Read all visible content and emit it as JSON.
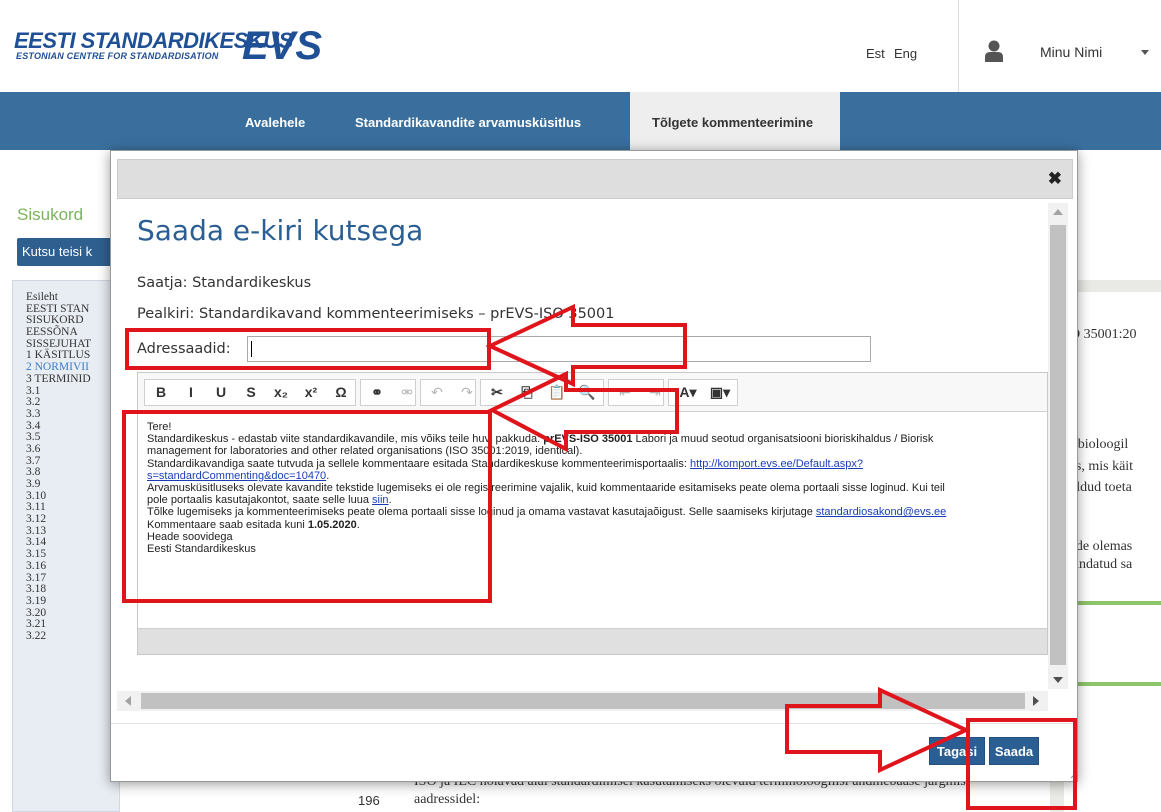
{
  "header": {
    "logo_main": "EESTI STANDARDIKESKUS",
    "logo_sub": "ESTONIAN CENTRE FOR STANDARDISATION",
    "logo_mark": "EVS",
    "lang_est": "Est",
    "lang_eng": "Eng",
    "user_icon": "user-icon",
    "user_name": "Minu Nimi"
  },
  "nav": {
    "items": [
      {
        "label": "Avalehele"
      },
      {
        "label": "Standardikavandite arvamusküsitlus"
      },
      {
        "label": "Tõlgete kommenteerimine"
      }
    ]
  },
  "background": {
    "section_title": "Sisukord",
    "invite_button": "Kutsu teisi k",
    "toc": [
      "Esileht",
      "EESTI STAN",
      "SISUKORD",
      "EESSÕNA",
      "SISSEJUHAT",
      "1 KÄSITLUS",
      "2 NORMIVII",
      "3 TERMINID",
      "3.1",
      "3.2",
      "3.3",
      "3.4",
      "3.5",
      "3.6",
      "3.7",
      "3.8",
      "3.9",
      "3.10",
      "3.11",
      "3.12",
      "3.13",
      "3.14",
      "3.15",
      "3.16",
      "3.17",
      "3.18",
      "3.19",
      "3.20",
      "3.21",
      "3.22"
    ],
    "right_snippets": [
      "O 35001:20",
      "e bioloogil",
      "is, mis käit",
      "eldud toeta",
      "ide olemas",
      "undatud sa"
    ],
    "bottom_line1": "ISO ja IEC hoiavad alal standardimisel kasutamiseks olevaid terminoloogilisi andmebaase järgmis",
    "bottom_line2": "aadressidel:",
    "bottom_number": "196"
  },
  "modal": {
    "close_icon": "close-icon",
    "title": "Saada e-kiri kutsega",
    "sender_label": "Saatja:",
    "sender_value": "Standardikeskus",
    "subject_label": "Pealkiri:",
    "subject_value": "Standardikavand kommenteerimiseks – prEVS-ISO 35001",
    "recipients_label": "Adressaadid:",
    "recipients_value": "",
    "toolbar": [
      {
        "icon": "bold-icon",
        "glyph": "B"
      },
      {
        "icon": "italic-icon",
        "glyph": "I"
      },
      {
        "icon": "underline-icon",
        "glyph": "U"
      },
      {
        "icon": "strikethrough-icon",
        "glyph": "S"
      },
      {
        "icon": "subscript-icon",
        "glyph": "x₂"
      },
      {
        "icon": "superscript-icon",
        "glyph": "x²"
      },
      {
        "icon": "special-char-icon",
        "glyph": "Ω"
      },
      {
        "icon": "link-icon",
        "glyph": "⚭"
      },
      {
        "icon": "unlink-icon",
        "glyph": "⚮"
      },
      {
        "icon": "undo-icon",
        "glyph": "↶"
      },
      {
        "icon": "redo-icon",
        "glyph": "↷"
      },
      {
        "icon": "cut-icon",
        "glyph": "✂"
      },
      {
        "icon": "copy-icon",
        "glyph": "⎘"
      },
      {
        "icon": "paste-icon",
        "glyph": "📋"
      },
      {
        "icon": "find-icon",
        "glyph": "🔍"
      },
      {
        "icon": "replace-icon",
        "glyph": "ᵇa"
      },
      {
        "icon": "outdent-icon",
        "glyph": "⇤"
      },
      {
        "icon": "indent-icon",
        "glyph": "⇥"
      },
      {
        "icon": "text-color-icon",
        "glyph": "A▾"
      },
      {
        "icon": "bg-color-icon",
        "glyph": "▣▾"
      }
    ],
    "body": {
      "greeting": "Tere!",
      "l1_pre": "Standardikeskus - edastab viite standardikavandile, mis võiks teile huvi pakkuda: ",
      "l1_bold": "prEVS-ISO 35001",
      "l1_post": " Labori ja muud seotud organisatsiooni bioriskihaldus / Biorisk",
      "l2": "management for laboratories and other related organisations (ISO 35001:2019, identical).",
      "l3_pre": "Standardikavandiga saate tutvuda ja sellele kommentaare esitada Standardikeskuse kommenteerimisportaalis: ",
      "l3_link": "http://komport.evs.ee/Default.aspx?",
      "l4_link": "s=standardCommenting&doc=10470",
      "l4_post": ".",
      "l5": "Arvamusküsitluseks olevate kavandite tekstide lugemiseks ei ole registreerimine vajalik, kuid kommentaaride esitamiseks peate olema portaali sisse loginud. Kui teil",
      "l6_pre": "pole portaalis kasutajakontot, saate selle luua ",
      "l6_link": "siin",
      "l6_post": ".",
      "l7_pre": "Tõlke lugemiseks ja kommenteerimiseks peate olema portaali sisse loginud ja omama vastavat kasutajaõigust. Selle saamiseks kirjutage ",
      "l7_link": "standardiosakond@evs.ee",
      "l8_pre": "Kommentaare saab esitada kuni ",
      "l8_bold": "1.05.2020",
      "l8_post": ".",
      "l9": "Heade soovidega",
      "l10": "Eesti Standardikeskus"
    },
    "back_button": "Tagasi",
    "send_button": "Saada"
  },
  "colors": {
    "brand_blue": "#1f4f95",
    "nav_blue": "#3a6f9d",
    "accent_green": "#7ab55c",
    "annotation_red": "#e0151b"
  }
}
